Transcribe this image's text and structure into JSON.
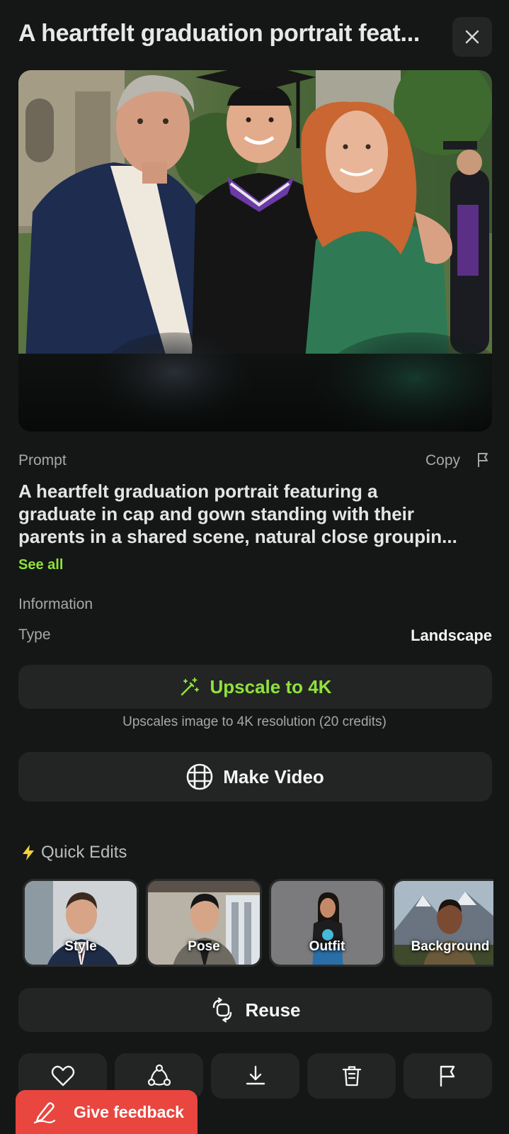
{
  "header": {
    "title": "A heartfelt graduation portrait feat...",
    "close_icon": "close-icon"
  },
  "image": {
    "description_icon": "hero-image"
  },
  "prompt": {
    "label": "Prompt",
    "copy_label": "Copy",
    "lines": [
      "A heartfelt graduation portrait featuring a",
      "graduate in cap and gown standing with their",
      "parents in a shared scene, natural close groupin..."
    ],
    "see_all": "See all"
  },
  "information": {
    "label": "Information",
    "type_label": "Type",
    "type_value": "Landscape"
  },
  "actions": {
    "upscale_label": "Upscale to 4K",
    "upscale_note": "Upscales image to 4K resolution (20 credits)",
    "make_video_label": "Make Video",
    "reuse_label": "Reuse"
  },
  "quick_edits": {
    "label": "Quick Edits",
    "items": [
      {
        "label": "Style"
      },
      {
        "label": "Pose"
      },
      {
        "label": "Outfit"
      },
      {
        "label": "Background"
      }
    ]
  },
  "bottom_icons": [
    "heart-icon",
    "share-icon",
    "download-icon",
    "trash-icon",
    "flag-icon"
  ],
  "feedback": {
    "label": "Give feedback"
  },
  "colors": {
    "background": "#151716",
    "accent_green": "#8fe23b",
    "feedback_red": "#e8463f",
    "button_bg": "#232524"
  }
}
